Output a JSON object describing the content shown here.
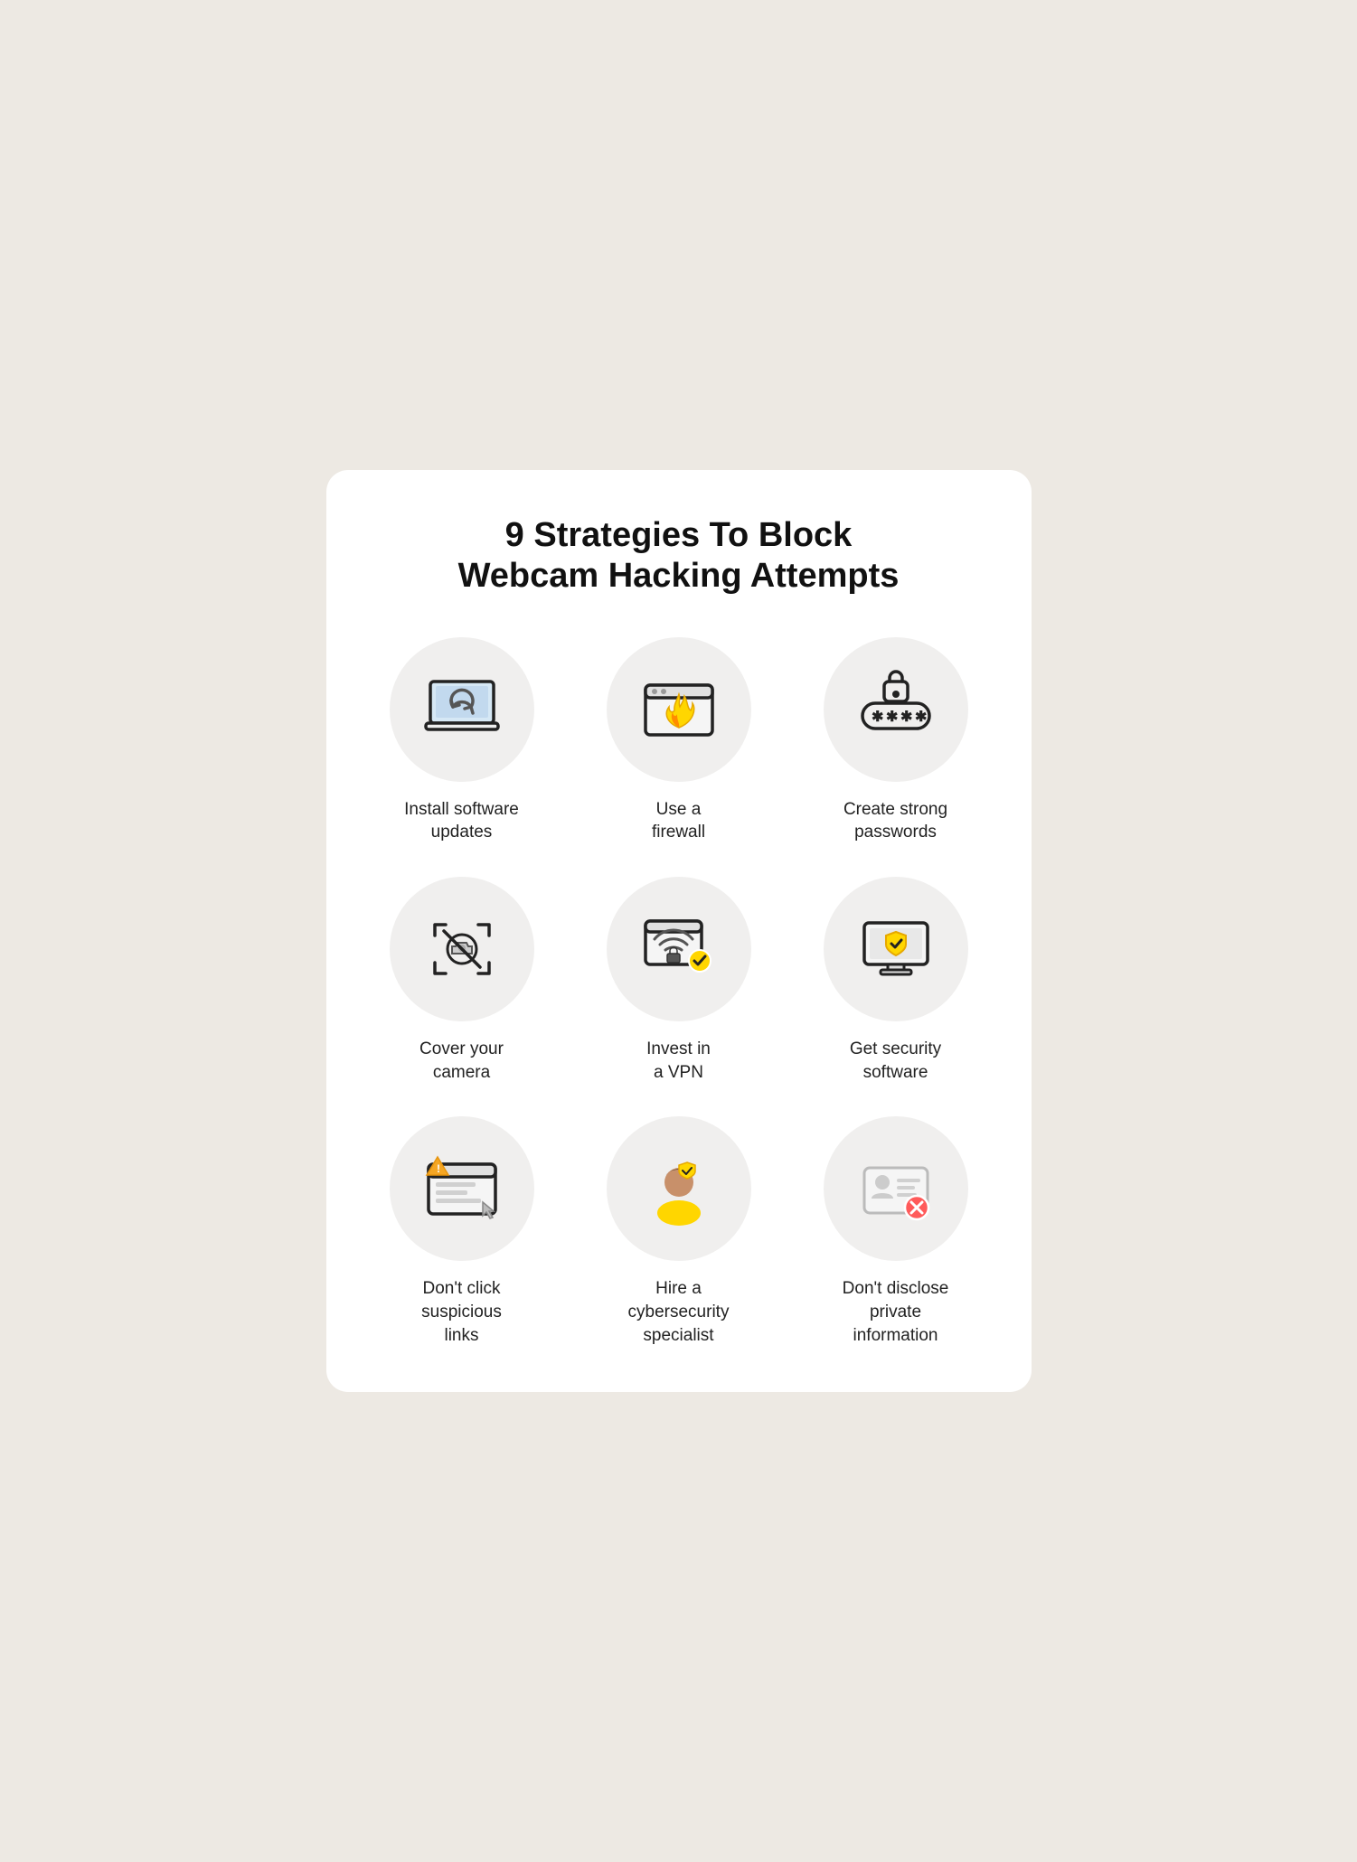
{
  "title": "9 Strategies To Block\nWebcam Hacking Attempts",
  "items": [
    {
      "id": "software-updates",
      "label": "Install software\nupdates"
    },
    {
      "id": "firewall",
      "label": "Use a\nfirewall"
    },
    {
      "id": "strong-passwords",
      "label": "Create strong\npasswords"
    },
    {
      "id": "cover-camera",
      "label": "Cover your\ncamera"
    },
    {
      "id": "vpn",
      "label": "Invest in\na VPN"
    },
    {
      "id": "security-software",
      "label": "Get security\nsoftware"
    },
    {
      "id": "suspicious-links",
      "label": "Don't click\nsuspicious\nlinks"
    },
    {
      "id": "cybersecurity-specialist",
      "label": "Hire a\ncybersecurity\nspecialist"
    },
    {
      "id": "private-information",
      "label": "Don't disclose\nprivate\ninformation"
    }
  ]
}
